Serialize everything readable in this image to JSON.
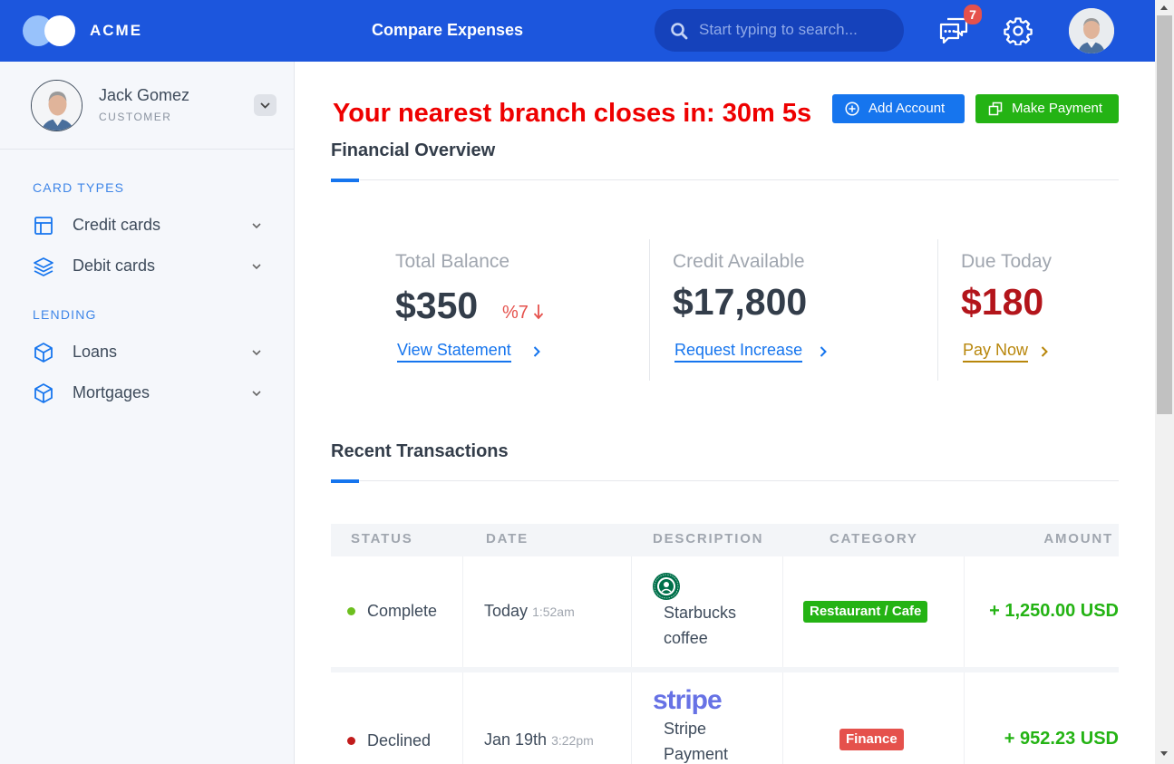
{
  "header": {
    "brand": "ACME",
    "title": "Compare Expenses",
    "search_placeholder": "Start typing to search...",
    "notification_count": "7"
  },
  "sidebar": {
    "user": {
      "name": "Jack Gomez",
      "role": "CUSTOMER"
    },
    "sections": [
      {
        "label": "CARD TYPES",
        "items": [
          {
            "label": "Credit cards",
            "icon": "layout-icon"
          },
          {
            "label": "Debit cards",
            "icon": "layers-icon"
          }
        ]
      },
      {
        "label": "LENDING",
        "items": [
          {
            "label": "Loans",
            "icon": "box-icon"
          },
          {
            "label": "Mortgages",
            "icon": "box-icon"
          }
        ]
      }
    ]
  },
  "main": {
    "countdown": "Your nearest branch closes in: 30m 5s",
    "actions": {
      "add_account": "Add Account",
      "make_payment": "Make Payment"
    },
    "overview_title": "Financial Overview",
    "stats": [
      {
        "label": "Total Balance",
        "value": "$350",
        "change": "%7",
        "link": "View Statement"
      },
      {
        "label": "Credit Available",
        "value": "$17,800",
        "link": "Request Increase"
      },
      {
        "label": "Due Today",
        "value": "$180",
        "link": "Pay Now"
      }
    ],
    "transactions_title": "Recent Transactions",
    "table": {
      "columns": [
        "STATUS",
        "DATE",
        "DESCRIPTION",
        "CATEGORY",
        "AMOUNT"
      ],
      "rows": [
        {
          "status": "Complete",
          "status_color": "#6dbf1f",
          "date": "Today",
          "time": "1:52am",
          "description": "Starbucks coffee",
          "logo": "starbucks-logo",
          "category": "Restaurant / Cafe",
          "category_color": "#24b314",
          "amount": "+ 1,250.00 USD"
        },
        {
          "status": "Declined",
          "status_color": "#c11b1b",
          "date": "Jan 19th",
          "time": "3:22pm",
          "logo_text": "stripe",
          "description": "Stripe Payment",
          "logo": "stripe-logo",
          "category": "Finance",
          "category_color": "#e5514c",
          "amount": "+ 952.23 USD"
        }
      ]
    }
  },
  "colors": {
    "header_bg": "#1c56dd",
    "accent": "#1675ee",
    "success": "#24b314",
    "danger": "#ee0000"
  }
}
